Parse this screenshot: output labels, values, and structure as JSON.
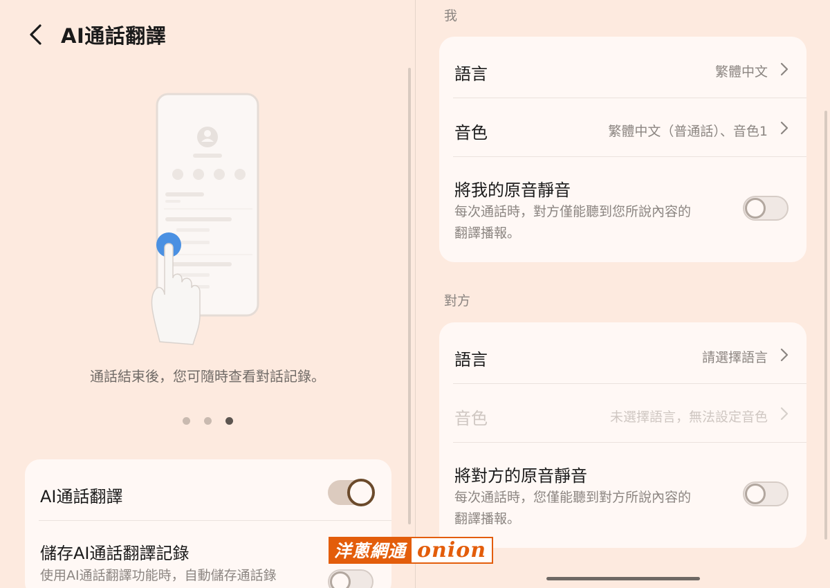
{
  "header": {
    "title": "AI通話翻譯"
  },
  "onboarding": {
    "caption": "通話結束後，您可隨時查看對話記錄。",
    "pages": 3,
    "current_page": 3
  },
  "left_card": {
    "ai_translate": {
      "label": "AI通話翻譯",
      "enabled": true
    },
    "save_record": {
      "label": "儲存AI通話翻譯記錄",
      "description": "使用AI通話翻譯功能時，自動儲存通話錄",
      "enabled": false
    }
  },
  "me": {
    "section_label": "我",
    "language": {
      "label": "語言",
      "value": "繁體中文"
    },
    "voice": {
      "label": "音色",
      "value": "繁體中文（普通話）、音色1"
    },
    "mute": {
      "label": "將我的原音靜音",
      "description_line1": "每次通話時，對方僅能聽到您所說內容的",
      "description_line2": "翻譯播報。",
      "enabled": false
    }
  },
  "other": {
    "section_label": "對方",
    "language": {
      "label": "語言",
      "value": "請選擇語言"
    },
    "voice": {
      "label": "音色",
      "value": "未選擇語言，無法設定音色",
      "disabled": true
    },
    "mute": {
      "label": "將對方的原音靜音",
      "description_line1": "每次通話時，您僅能聽到對方所說內容的",
      "description_line2": "翻譯播報。",
      "enabled": false
    }
  },
  "watermark": {
    "zh": "洋蔥網通",
    "en": "onion"
  },
  "colors": {
    "background": "#fdeadf",
    "card": "#fff8f5",
    "toggle_on": "#6b4a2b",
    "accent_blue": "#4a90e2",
    "watermark": "#e35d0b"
  }
}
